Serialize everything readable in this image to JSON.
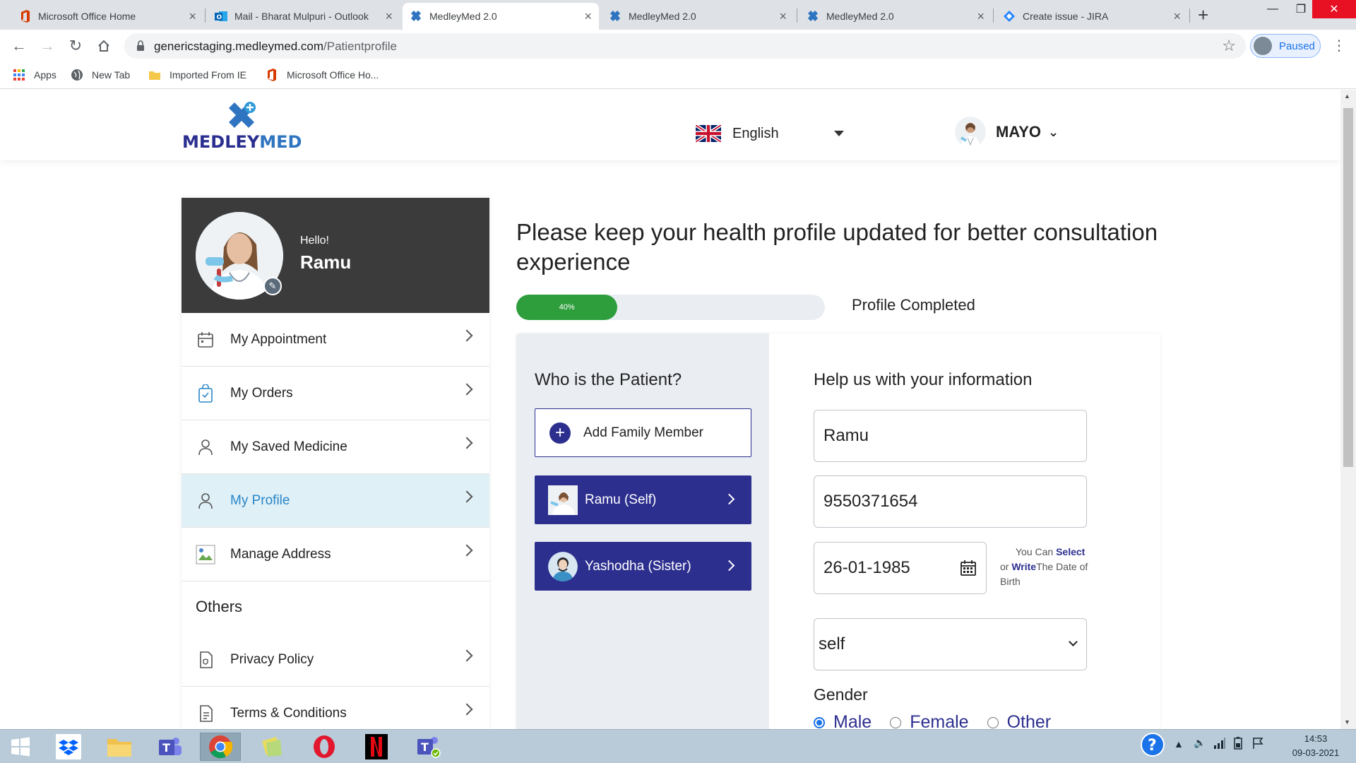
{
  "browser": {
    "tabs": [
      {
        "title": "Microsoft Office Home",
        "icon": "office-icon"
      },
      {
        "title": "Mail - Bharat Mulpuri - Outlook",
        "icon": "outlook-icon"
      },
      {
        "title": "MedleyMed 2.0",
        "icon": "medleymed-icon",
        "active": true
      },
      {
        "title": "MedleyMed 2.0",
        "icon": "medleymed-icon"
      },
      {
        "title": "MedleyMed 2.0",
        "icon": "medleymed-icon"
      },
      {
        "title": "Create issue - JIRA",
        "icon": "jira-icon"
      }
    ],
    "url_host": "genericstaging.medleymed.com",
    "url_path": "/Patientprofile",
    "profile_status": "Paused",
    "bookmarks": [
      "Apps",
      "New Tab",
      "Imported From IE",
      "Microsoft Office Ho..."
    ]
  },
  "header": {
    "logo_left": "MEDLEY",
    "logo_right": "MED",
    "language": "English",
    "user_name": "MAYO"
  },
  "sidebar": {
    "greeting": "Hello!",
    "name": "Ramu",
    "items": [
      {
        "label": "My Appointment",
        "icon": "calendar-icon"
      },
      {
        "label": "My Orders",
        "icon": "shopping-bag-icon"
      },
      {
        "label": "My Saved Medicine",
        "icon": "person-icon"
      },
      {
        "label": "My Profile",
        "icon": "person-icon",
        "active": true
      },
      {
        "label": "Manage Address",
        "icon": "broken-image-icon"
      }
    ],
    "others_heading": "Others",
    "other_items": [
      {
        "label": "Privacy Policy",
        "icon": "shield-document-icon"
      },
      {
        "label": "Terms & Conditions",
        "icon": "document-icon"
      }
    ]
  },
  "main": {
    "headline": "Please keep your health profile updated for better consultation experience",
    "progress_percent": 40,
    "progress_text": "40%",
    "progress_label": "Profile Completed",
    "patient_heading": "Who is the Patient?",
    "add_member_label": "Add Family Member",
    "members": [
      {
        "label": "Ramu (Self)"
      },
      {
        "label": "Yashodha (Sister)"
      }
    ],
    "info_heading": "Help us with your information",
    "name_value": "Ramu",
    "phone_value": "9550371654",
    "dob_value": "26-01-1985",
    "dob_hint_1": "You Can ",
    "dob_hint_select": "Select",
    "dob_hint_2": "or ",
    "dob_hint_write": "Write",
    "dob_hint_3": "The Date of Birth",
    "relation_value": "self",
    "gender_label": "Gender",
    "gender_options": [
      "Male",
      "Female",
      "Other"
    ],
    "gender_selected": "Male"
  },
  "taskbar": {
    "time": "14:53",
    "date": "09-03-2021"
  },
  "colors": {
    "brand_navy": "#2d2f8f",
    "progress_green": "#2e9e3d",
    "sidebar_dark": "#3b3b3b",
    "active_item_bg": "#dff0f7"
  }
}
